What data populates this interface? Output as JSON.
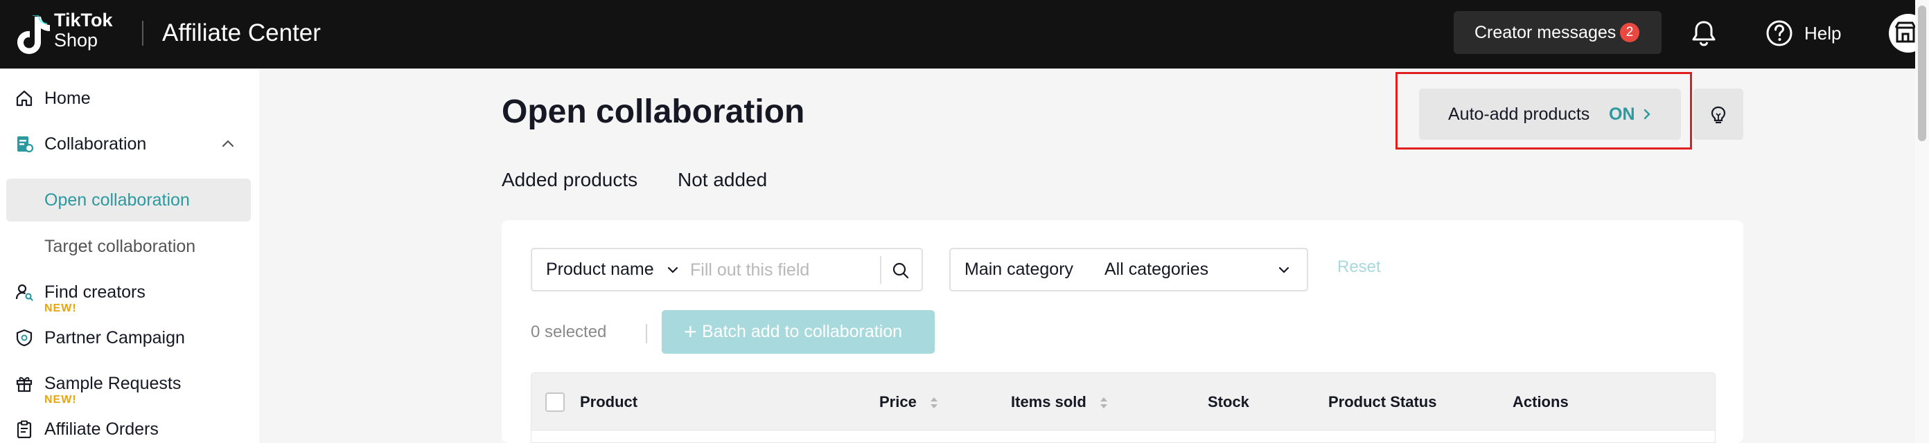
{
  "topbar": {
    "logo_line1": "TikTok",
    "logo_line2": "Shop",
    "app_title": "Affiliate Center",
    "creator_messages_label": "Creator messages",
    "creator_messages_count": "2",
    "help_label": "Help",
    "bell_icon": "bell-icon",
    "help_icon": "help-circle-icon"
  },
  "sidebar": {
    "items": [
      {
        "label": "Home",
        "icon": "home-icon"
      },
      {
        "label": "Collaboration",
        "icon": "collaboration-icon"
      },
      {
        "label": "Open collaboration",
        "active": true
      },
      {
        "label": "Target collaboration"
      },
      {
        "label": "Find creators",
        "icon": "find-creators-icon",
        "tag": "NEW!"
      },
      {
        "label": "Partner Campaign",
        "icon": "partner-campaign-icon"
      },
      {
        "label": "Sample Requests",
        "icon": "gift-icon",
        "tag": "NEW!"
      },
      {
        "label": "Affiliate Orders",
        "icon": "clipboard-icon"
      }
    ]
  },
  "main": {
    "page_title": "Open collaboration",
    "auto_add_label": "Auto-add products",
    "auto_add_state": "ON",
    "tabs": [
      {
        "label": "Added products"
      },
      {
        "label": "Not added"
      }
    ],
    "filters": {
      "search_field_select": "Product name",
      "search_placeholder": "Fill out this field",
      "category_label": "Main category",
      "category_value": "All categories",
      "reset_label": "Reset"
    },
    "selected_count": "0 selected",
    "batch_add_label": "Batch add to collaboration",
    "table": {
      "columns": [
        "Product",
        "Price",
        "Items sold",
        "Stock",
        "Product Status",
        "Actions"
      ]
    }
  },
  "colors": {
    "accent": "#2a9aa0",
    "accent_disabled": "#a8d9dc",
    "topbar_bg": "#121212",
    "badge": "#e8483f",
    "highlight_border": "#e01f1f"
  }
}
